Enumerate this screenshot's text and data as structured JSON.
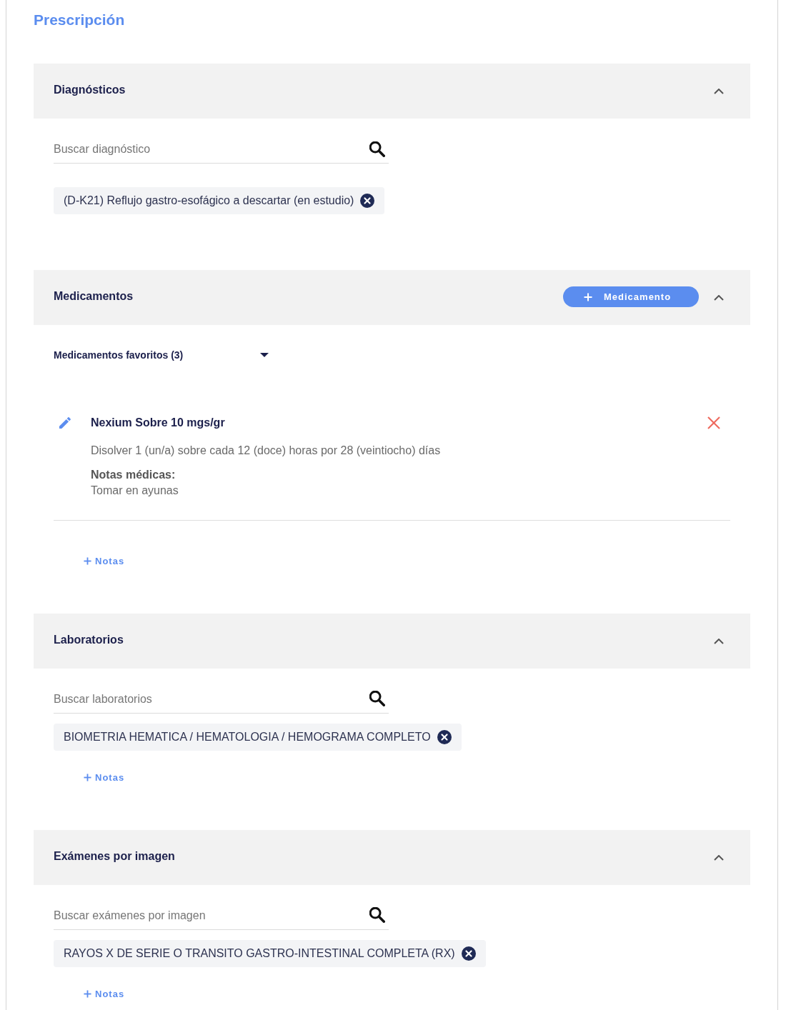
{
  "page": {
    "title": "Prescripción"
  },
  "sections": [
    {
      "kind": "diagnoses",
      "title": "Diagnósticos",
      "expanded": true,
      "search": {
        "placeholder": "Buscar diagnóstico"
      },
      "tags": [
        {
          "label": "(D-K21) Reflujo gastro-esofágico a descartar (en estudio)"
        }
      ]
    },
    {
      "kind": "medications",
      "title": "Medicamentos",
      "expanded": true,
      "add_button": {
        "label": "Medicamento"
      },
      "favorites": {
        "label": "Medicamentos favoritos (3)",
        "expanded": false
      },
      "items": [
        {
          "name": "Nexium Sobre 10 mgs/gr",
          "instructions": "Disolver 1 (un/a) sobre cada 12 (doce) horas por 28 (veintiocho) días",
          "notes_label": "Notas médicas:",
          "notes": "Tomar en ayunas"
        }
      ],
      "notes_link": {
        "label": "Notas"
      }
    },
    {
      "kind": "studies",
      "title": "Laboratorios",
      "expanded": true,
      "search": {
        "placeholder": "Buscar laboratorios"
      },
      "tags": [
        {
          "label": "BIOMETRIA HEMATICA / HEMATOLOGIA / HEMOGRAMA COMPLETO"
        }
      ],
      "notes_link": {
        "label": "Notas"
      }
    },
    {
      "kind": "studies",
      "title": "Exámenes por imagen",
      "expanded": true,
      "search": {
        "placeholder": "Buscar exámenes por imagen"
      },
      "tags": [
        {
          "label": "RAYOS X DE SERIE O TRANSITO GASTRO-INTESTINAL COMPLETA (RX)"
        }
      ],
      "notes_link": {
        "label": "Notas"
      }
    }
  ]
}
